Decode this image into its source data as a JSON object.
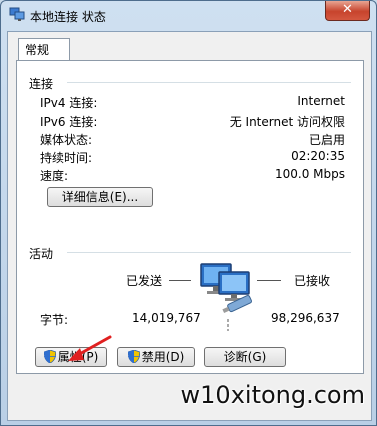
{
  "window": {
    "title": "本地连接 状态",
    "close_label": "✕"
  },
  "tab": {
    "label": "常规"
  },
  "connection": {
    "heading": "连接",
    "rows": [
      {
        "label": "IPv4 连接:",
        "value": "Internet"
      },
      {
        "label": "IPv6 连接:",
        "value": "无 Internet 访问权限"
      },
      {
        "label": "媒体状态:",
        "value": "已启用"
      },
      {
        "label": "持续时间:",
        "value": "02:20:35"
      },
      {
        "label": "速度:",
        "value": "100.0 Mbps"
      }
    ],
    "details_button": "详细信息(E)..."
  },
  "activity": {
    "heading": "活动",
    "sent_label": "已发送",
    "received_label": "已接收",
    "bytes_label": "字节:",
    "bytes_sent": "14,019,767",
    "bytes_received": "98,296,637"
  },
  "buttons": {
    "properties": "属性(P)",
    "disable": "禁用(D)",
    "diagnose": "诊断(G)"
  },
  "watermark": "w10xitong.com",
  "colors": {
    "title_bg": "#c9daea",
    "close_red": "#c7442d",
    "arrow_red": "#e02020",
    "monitor_blue": "#2a6fc4"
  },
  "icons": [
    "network-connection-icon",
    "close-icon",
    "shield-icon",
    "network-computers-icon"
  ]
}
